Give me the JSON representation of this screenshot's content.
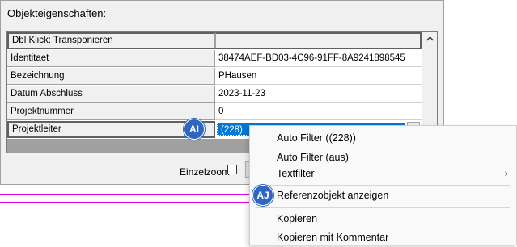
{
  "panel": {
    "title": "Objekteigenschaften:",
    "grid": {
      "header_row": "Dbl Klick: Transponieren",
      "rows": [
        {
          "name": "Identitaet",
          "value": "38474AEF-BD03-4C96-91FF-8A9241898545"
        },
        {
          "name": "Bezeichnung",
          "value": "PHausen"
        },
        {
          "name": "Datum Abschluss",
          "value": "2023-11-23"
        },
        {
          "name": "Projektnummer",
          "value": "0"
        },
        {
          "name": "Projektleiter",
          "value": "(228)"
        }
      ],
      "scroll_up_icon": "chevron-up-icon",
      "dropdown_icon": "chevron-down-icon"
    },
    "einzelzoom_label": "Einzelzoom",
    "einzelzoom_checked": false
  },
  "badges": {
    "ai": "AI",
    "aj": "AJ"
  },
  "context_menu": {
    "items": [
      {
        "label": "Auto Filter ((228))"
      },
      {
        "label": "Auto Filter (aus)"
      },
      {
        "label": "Textfilter",
        "submenu_arrow": "›"
      },
      {
        "label": "Referenzobjekt anzeigen"
      },
      {
        "label": "Kopieren"
      },
      {
        "label": "Kopieren mit Kommentar"
      }
    ]
  },
  "colors": {
    "selection": "#0078d7",
    "badge": "#3066be",
    "pink_lines": "#e000d8"
  }
}
